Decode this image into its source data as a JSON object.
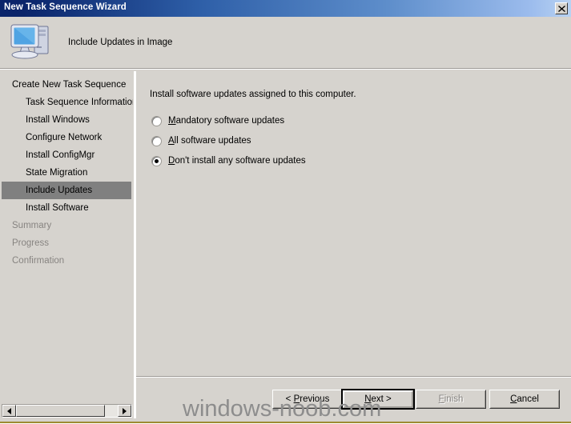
{
  "window": {
    "title": "New Task Sequence Wizard",
    "close_label": "close-window",
    "header_title": "Include Updates in Image",
    "header_icon": "computer-icon",
    "titlebar_color_left": "#0a246a",
    "titlebar_color_right": "#b8d2f2",
    "face_color": "#d6d3ce",
    "selection_color": "#808080"
  },
  "sidebar": {
    "items": [
      {
        "label": "Create New Task Sequence",
        "level": 0,
        "state": "normal"
      },
      {
        "label": "Task Sequence Information",
        "level": 1,
        "state": "normal"
      },
      {
        "label": "Install Windows",
        "level": 1,
        "state": "normal"
      },
      {
        "label": "Configure Network",
        "level": 1,
        "state": "normal"
      },
      {
        "label": "Install ConfigMgr",
        "level": 1,
        "state": "normal"
      },
      {
        "label": "State Migration",
        "level": 1,
        "state": "normal"
      },
      {
        "label": "Include Updates",
        "level": 1,
        "state": "selected"
      },
      {
        "label": "Install Software",
        "level": 1,
        "state": "normal"
      },
      {
        "label": "Summary",
        "level": 0,
        "state": "disabled"
      },
      {
        "label": "Progress",
        "level": 0,
        "state": "disabled"
      },
      {
        "label": "Confirmation",
        "level": 0,
        "state": "disabled"
      }
    ],
    "scrollbar": {
      "left_arrow": "scroll-left-arrow",
      "right_arrow": "scroll-right-arrow",
      "thumb": "scroll-thumb"
    }
  },
  "main": {
    "instruction": "Install software updates assigned to this computer.",
    "options": [
      {
        "prefix": "",
        "accesskey": "M",
        "suffix": "andatory software updates",
        "checked": false
      },
      {
        "prefix": "",
        "accesskey": "A",
        "suffix": "ll software updates",
        "checked": false
      },
      {
        "prefix": "",
        "accesskey": "D",
        "suffix": "on't install any software updates",
        "checked": true
      }
    ]
  },
  "footer": {
    "buttons": [
      {
        "prefix": "< ",
        "accesskey": "P",
        "suffix": "revious",
        "state": "enabled",
        "default": false
      },
      {
        "prefix": "",
        "accesskey": "N",
        "suffix": "ext >",
        "state": "enabled",
        "default": true
      },
      {
        "prefix": "",
        "accesskey": "F",
        "suffix": "inish",
        "state": "disabled",
        "default": false
      },
      {
        "prefix": "",
        "accesskey": "C",
        "suffix": "ancel",
        "state": "enabled",
        "default": false
      }
    ]
  },
  "watermark": {
    "text": "windows-noob.com"
  }
}
